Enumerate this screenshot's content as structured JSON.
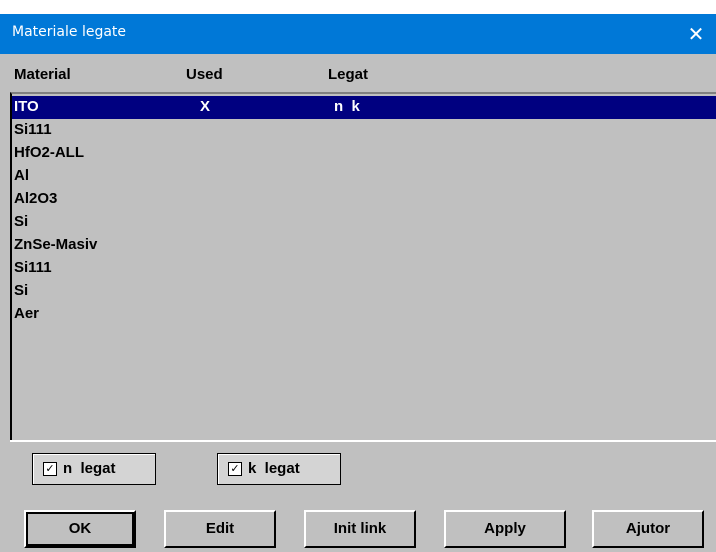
{
  "window": {
    "title": "Materiale legate",
    "close_glyph": "✕"
  },
  "columns": {
    "material": "Material",
    "used": "Used",
    "legat": "Legat"
  },
  "rows": [
    {
      "material": "ITO",
      "used": "X",
      "legat": "n  k",
      "selected": true
    },
    {
      "material": "Si111",
      "used": "",
      "legat": ""
    },
    {
      "material": "HfO2-ALL",
      "used": "",
      "legat": ""
    },
    {
      "material": "Al",
      "used": "",
      "legat": ""
    },
    {
      "material": "Al2O3",
      "used": "",
      "legat": ""
    },
    {
      "material": "Si",
      "used": "",
      "legat": ""
    },
    {
      "material": "ZnSe-Masiv",
      "used": "",
      "legat": ""
    },
    {
      "material": "Si111",
      "used": "",
      "legat": ""
    },
    {
      "material": "Si",
      "used": "",
      "legat": ""
    },
    {
      "material": "Aer",
      "used": "",
      "legat": ""
    }
  ],
  "checks": {
    "n_legat": {
      "label": "n  legat",
      "checked": true,
      "mark": "✓"
    },
    "k_legat": {
      "label": "k  legat",
      "checked": true,
      "mark": "✓"
    }
  },
  "buttons": {
    "ok": "OK",
    "edit": "Edit",
    "init_link": "Init link",
    "apply": "Apply",
    "ajutor": "Ajutor"
  },
  "colors": {
    "title_bar": "#0078d7",
    "selection": "#000080",
    "face": "#c0c0c0"
  },
  "icons": {
    "close": "close-icon",
    "check": "checkmark-icon"
  }
}
